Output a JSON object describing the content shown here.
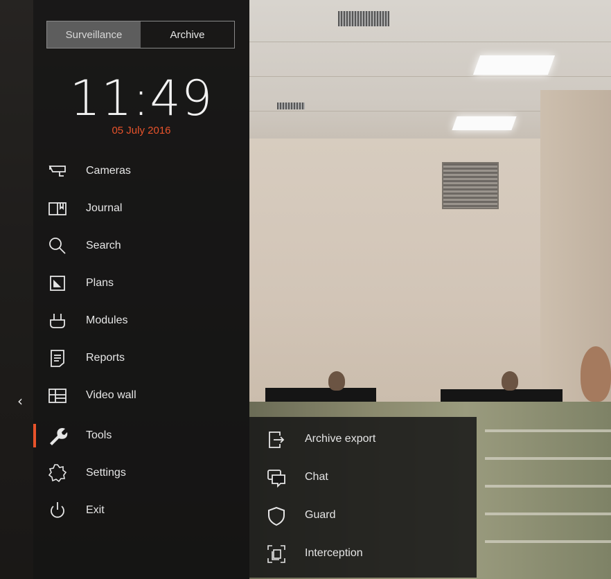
{
  "mode_switch": {
    "tabs": [
      {
        "label": "Surveillance",
        "active": true
      },
      {
        "label": "Archive",
        "active": false
      }
    ]
  },
  "clock": {
    "time": "11:49",
    "date": "05 July 2016"
  },
  "menu": {
    "items": [
      {
        "label": "Cameras",
        "icon": "camera-icon"
      },
      {
        "label": "Journal",
        "icon": "journal-icon"
      },
      {
        "label": "Search",
        "icon": "search-icon"
      },
      {
        "label": "Plans",
        "icon": "plans-icon"
      },
      {
        "label": "Modules",
        "icon": "plug-icon"
      },
      {
        "label": "Reports",
        "icon": "report-icon"
      },
      {
        "label": "Video wall",
        "icon": "video-wall-icon"
      },
      {
        "label": "Tools",
        "icon": "wrench-icon",
        "active": true
      },
      {
        "label": "Settings",
        "icon": "gear-icon"
      },
      {
        "label": "Exit",
        "icon": "power-icon"
      }
    ]
  },
  "submenu": {
    "items": [
      {
        "label": "Archive export",
        "icon": "export-icon"
      },
      {
        "label": "Chat",
        "icon": "chat-icon"
      },
      {
        "label": "Guard",
        "icon": "shield-icon"
      },
      {
        "label": "Interception",
        "icon": "interception-icon"
      }
    ]
  },
  "colors": {
    "accent": "#e8532b",
    "panel": "#121212",
    "text": "#e6e6e6"
  },
  "collapse_icon": "chevron-left-icon"
}
